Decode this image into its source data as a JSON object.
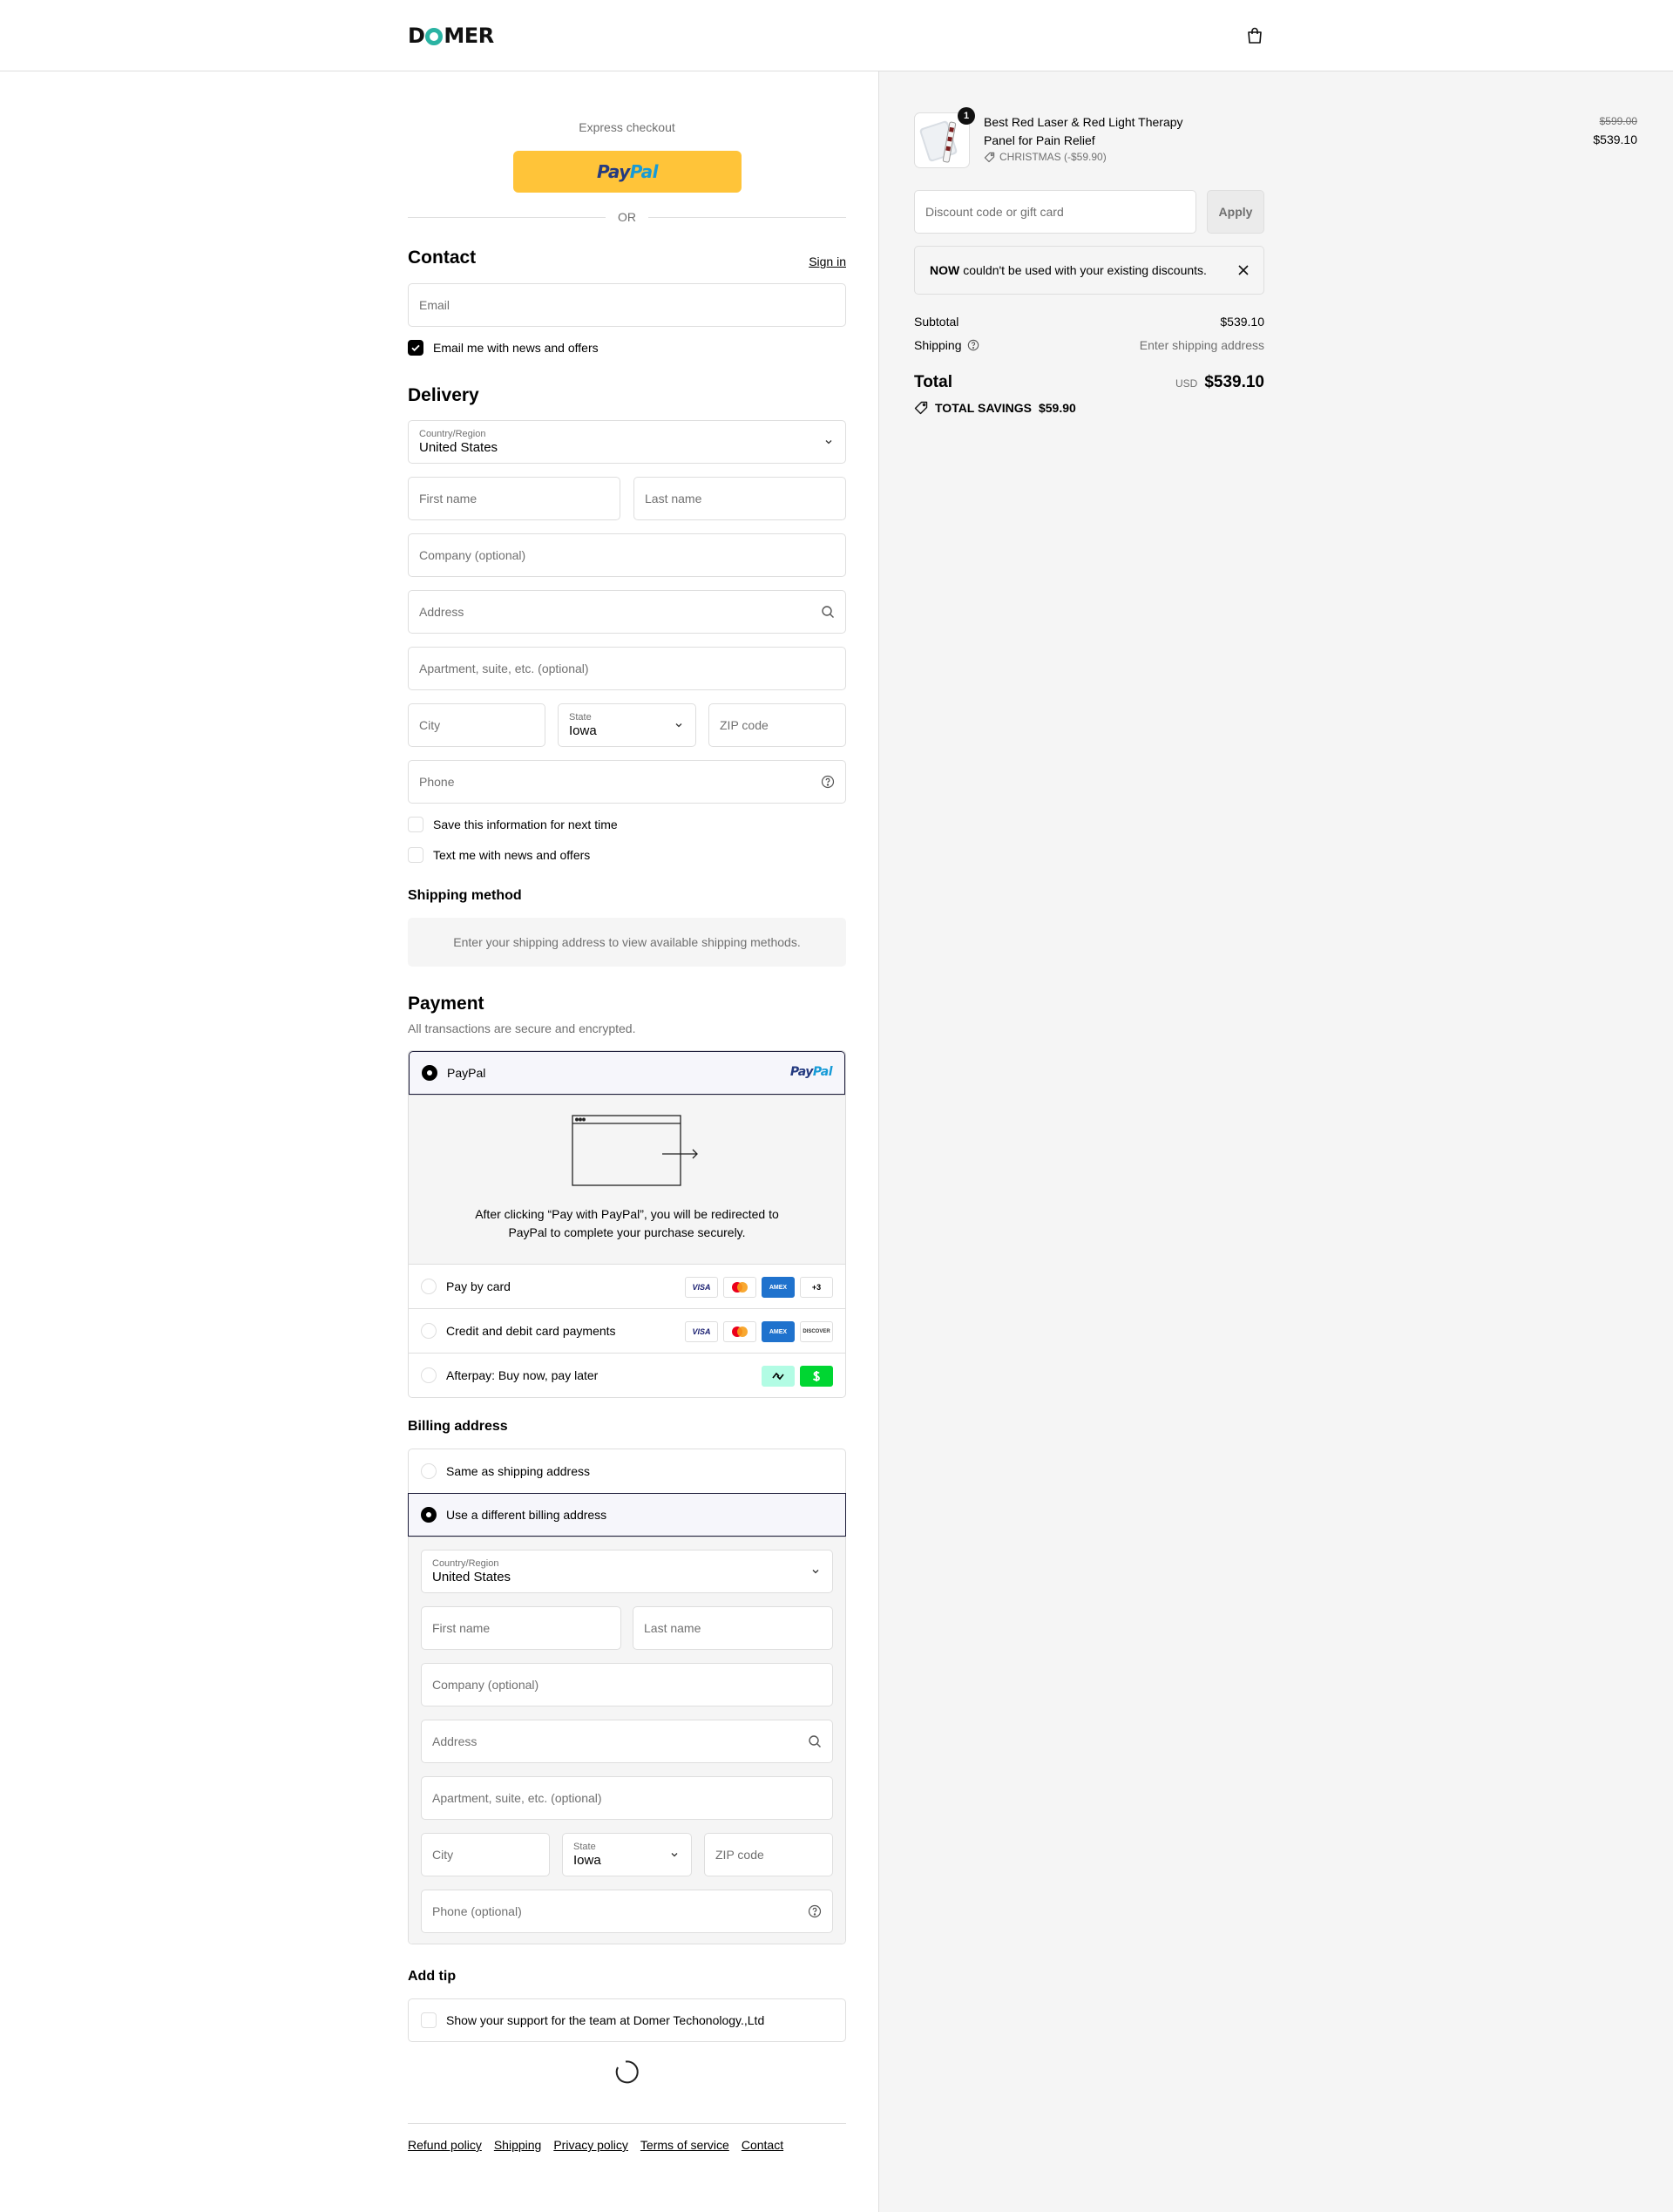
{
  "header": {
    "logo_text_1": "D",
    "logo_text_2": "MER",
    "bag_icon": "shopping-bag-icon"
  },
  "express": {
    "title": "Express checkout",
    "paypal_pay": "Pay",
    "paypal_pal": "Pal",
    "or_text": "OR"
  },
  "contact": {
    "title": "Contact",
    "sign_in": "Sign in",
    "email_placeholder": "Email",
    "email_news": "Email me with news and offers"
  },
  "delivery": {
    "title": "Delivery",
    "country_label": "Country/Region",
    "country_value": "United States",
    "first_name": "First name",
    "last_name": "Last name",
    "company": "Company (optional)",
    "address": "Address",
    "apartment": "Apartment, suite, etc. (optional)",
    "city": "City",
    "state_label": "State",
    "state_value": "Iowa",
    "zip": "ZIP code",
    "phone": "Phone",
    "save_info": "Save this information for next time",
    "text_news": "Text me with news and offers"
  },
  "shipping": {
    "title": "Shipping method",
    "message": "Enter your shipping address to view available shipping methods."
  },
  "payment": {
    "title": "Payment",
    "subtitle": "All transactions are secure and encrypted.",
    "paypal_label": "PayPal",
    "paypal_note_1": "After clicking “Pay with PayPal”, you will be redirected to",
    "paypal_note_2": "PayPal to complete your purchase securely.",
    "card_label": "Pay by card",
    "credit_label": "Credit and debit card payments",
    "afterpay_label": "Afterpay: Buy now, pay later",
    "more_cards": "+3",
    "visa": "VISA",
    "discover": "DISCOVER",
    "amex": "AMEX"
  },
  "billing": {
    "title": "Billing address",
    "same": "Same as shipping address",
    "different": "Use a different billing address",
    "country_label": "Country/Region",
    "country_value": "United States",
    "first_name": "First name",
    "last_name": "Last name",
    "company": "Company (optional)",
    "address": "Address",
    "apartment": "Apartment, suite, etc. (optional)",
    "city": "City",
    "state_label": "State",
    "state_value": "Iowa",
    "zip": "ZIP code",
    "phone": "Phone (optional)"
  },
  "tip": {
    "title": "Add tip",
    "label": "Show your support for the team at Domer Techonology.,Ltd"
  },
  "footer": {
    "links": [
      "Refund policy",
      "Shipping",
      "Privacy policy",
      "Terms of service",
      "Contact"
    ]
  },
  "summary": {
    "qty": "1",
    "product_name": "Best Red Laser & Red Light Therapy Panel for Pain Relief",
    "discount_tag": "CHRISTMAS (-$59.90)",
    "old_price": "$599.00",
    "new_price": "$539.10",
    "discount_placeholder": "Discount code or gift card",
    "apply": "Apply",
    "notice_code": "NOW",
    "notice_text": "couldn't be used with your existing discounts.",
    "subtotal_label": "Subtotal",
    "subtotal_value": "$539.10",
    "shipping_label": "Shipping",
    "shipping_value": "Enter shipping address",
    "total_label": "Total",
    "currency": "USD",
    "total_value": "$539.10",
    "savings_label": "TOTAL SAVINGS",
    "savings_value": "$59.90"
  },
  "colors": {
    "paypal_yellow": "#ffc439",
    "accent_dark": "#1d1d3a",
    "logo_teal": "#2ab3a3",
    "afterpay_mint": "#b2fce4",
    "cashapp_green": "#00d632"
  }
}
